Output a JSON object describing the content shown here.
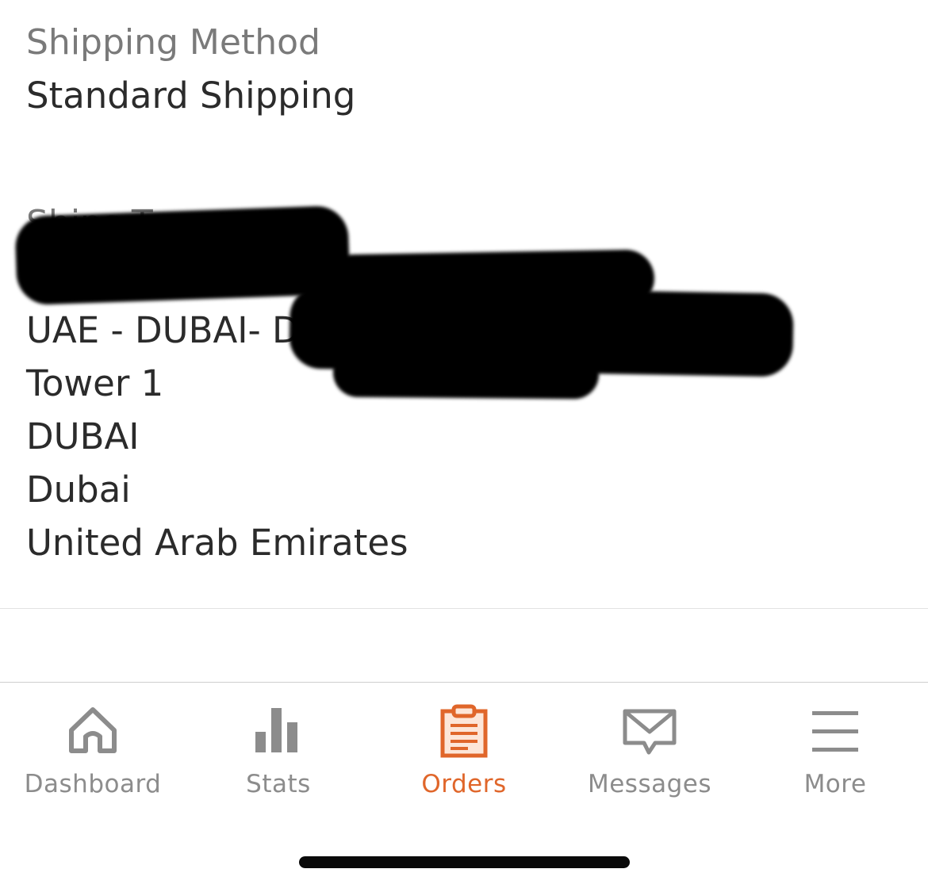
{
  "shipping": {
    "method_label": "Shipping Method",
    "method_value": "Standard Shipping"
  },
  "ships_to": {
    "label": "Ships To",
    "address_lines": [
      "UAE - DUBAI- D",
      "Tower 1",
      "DUBAI",
      "Dubai",
      "United Arab Emirates"
    ]
  },
  "tabbar": {
    "accent_color": "#e0662a",
    "inactive_color": "#8c8c8c",
    "tabs": [
      {
        "label": "Dashboard",
        "icon": "home-icon",
        "active": false
      },
      {
        "label": "Stats",
        "icon": "bar-chart-icon",
        "active": false
      },
      {
        "label": "Orders",
        "icon": "clipboard-icon",
        "active": true
      },
      {
        "label": "Messages",
        "icon": "envelope-icon",
        "active": false
      },
      {
        "label": "More",
        "icon": "menu-icon",
        "active": false
      }
    ]
  }
}
